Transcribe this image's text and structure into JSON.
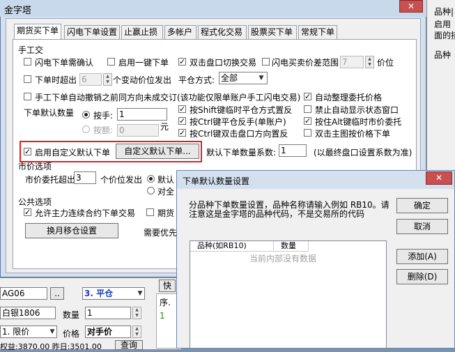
{
  "window": {
    "title": "金字塔",
    "close": "✕"
  },
  "right_pane": {
    "line1": "品种|",
    "line2": "启用",
    "line3": "面的接",
    "line4": "品种"
  },
  "tabs": [
    "期货买下单",
    "闪电下单设置",
    "止赢止损",
    "多帐户",
    "程式化交易",
    "股票买下单",
    "常规下单"
  ],
  "manual": {
    "group_title": "手工交",
    "opt_confirm": "闪电下单需确认",
    "opt_one_key": "启用一键下单",
    "opt_dblclick_switch": "双击盘口切换交易",
    "opt_price_range": "闪电买卖价差范围",
    "price_range_value": "7",
    "price_unit": "价位",
    "opt_timeout": "下单时超出",
    "timeout_value": "6",
    "timeout_suffix": "个变动价位发出",
    "close_mode_label": "平仓方式:",
    "close_mode_value": "全部",
    "opt_auto_cancel": "手工下单自动撤销之前同方向未成交订(该功能仅限单账户手工闪电交易)",
    "opt_auto_arrange": "自动整理委托价格",
    "qty_label": "下单默认数量",
    "by_hand": "按手:",
    "by_hand_value": "1",
    "by_amount": "按额:",
    "by_amount_value": "0",
    "yuan": "元",
    "shift_close": "按Shift键临时平仓方式置反",
    "no_status_window": "禁止自动显示状态窗口",
    "ctrl_reverse": "按Ctrl键平仓反手(单账户)",
    "alt_market": "按住Alt键临时市价委托",
    "ctrl_dbl": "按Ctrl键双击盘口方向置反",
    "dbl_main": "双击主图按价格下单",
    "enable_custom": "启用自定义默认下单",
    "custom_button": "自定义默认下单...",
    "coef_label": "默认下单数量系数:",
    "coef_value": "1",
    "coef_note": "(以最终盘口设置系数为准)"
  },
  "market": {
    "group_title": "市价选项",
    "exceed_label": "市价委托超出",
    "exceed_value": "3",
    "exceed_suffix": "个价位发出",
    "radio1": "默认",
    "radio2": "对全"
  },
  "common": {
    "group_title": "公共选项",
    "allow_main": "允许主力连续合约下单交易",
    "futures": "期货",
    "rollover_button": "换月移仓设置",
    "need_priority": "需要优先"
  },
  "bottom": {
    "code": "AG06",
    "dots": "..",
    "open_close": "3. 平仓",
    "contract": "白银1806",
    "qty_label": "数量",
    "qty_value": "1",
    "price_type": "1. 限价",
    "price_label": "价格",
    "price_value": "对手价",
    "status": "权益:3870.00 昨日:3501.00",
    "query": "查询",
    "tab": "快",
    "col_seq": "序.",
    "row1": "1"
  },
  "dialog": {
    "title": "下单默认数量设置",
    "close": "✕",
    "desc1": "分品种下单数量设置，品种名称请输入例如 RB10。请",
    "desc2": "注意这是金字塔的品种代码，不是交易所的代码",
    "ok": "确定",
    "cancel": "取消",
    "add": "添加(A)",
    "delete": "删除(D)",
    "col_variety": "品种(如RB10)",
    "col_qty": "数量",
    "empty": "当前内部没有数据"
  }
}
